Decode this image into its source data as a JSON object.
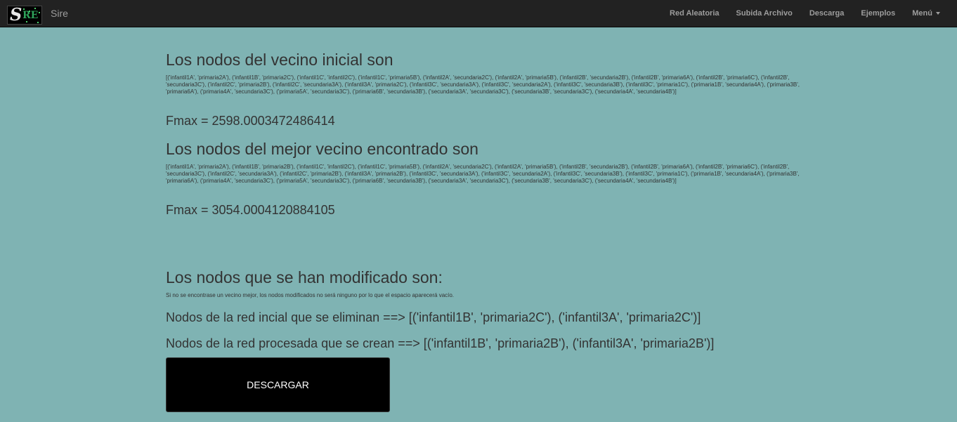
{
  "navbar": {
    "brand": "Sire",
    "links": [
      "Red Aleatoria",
      "Subida Archivo",
      "Descarga",
      "Ejemplos"
    ],
    "menu_label": "Menú"
  },
  "initial": {
    "heading": "Los nodos del vecino inicial son",
    "nodes_text": "[('infantil1A', 'primaria2A'), ('infantil1B', 'primaria2C'), ('infantil1C', 'infantil2C'), ('infantil1C', 'primaria5B'), ('infantil2A', 'secundaria2C'), ('infantil2A', 'primaria5B'), ('infantil2B', 'secundaria2B'), ('infantil2B', 'primaria6A'), ('infantil2B', 'primaria6C'), ('infantil2B', 'secundaria3C'), ('infantil2C', 'primaria2B'), ('infantil2C', 'secundaria3A'), ('infantil3A', 'primaria2C'), ('infantil3C', 'secundaria3A'), ('infantil3C', 'secundaria2A'), ('infantil3C', 'secundaria3B'), ('infantil3C', 'primaria1C'), ('primaria1B', 'secundaria4A'), ('primaria3B', 'primaria6A'), ('primaria4A', 'secundaria3C'), ('primaria5A', 'secundaria3C'), ('primaria6B', 'secundaria3B'), ('secundaria3A', 'secundaria3C'), ('secundaria3B', 'secundaria3C'), ('secundaria4A', 'secundaria4B')]",
    "fmax": "Fmax = 2598.0003472486414"
  },
  "best": {
    "heading": "Los nodos del mejor vecino encontrado son",
    "nodes_text": "[('infantil1A', 'primaria2A'), ('infantil1B', 'primaria2B'), ('infantil1C', 'infantil2C'), ('infantil1C', 'primaria5B'), ('infantil2A', 'secundaria2C'), ('infantil2A', 'primaria5B'), ('infantil2B', 'secundaria2B'), ('infantil2B', 'primaria6A'), ('infantil2B', 'primaria6C'), ('infantil2B', 'secundaria3C'), ('infantil2C', 'secundaria3A'), ('infantil2C', 'primaria2B'), ('infantil3A', 'primaria2B'), ('infantil3C', 'secundaria3A'), ('infantil3C', 'secundaria2A'), ('infantil3C', 'secundaria3B'), ('infantil3C', 'primaria1C'), ('primaria1B', 'secundaria4A'), ('primaria3B', 'primaria6A'), ('primaria4A', 'secundaria3C'), ('primaria5A', 'secundaria3C'), ('primaria6B', 'secundaria3B'), ('secundaria3A', 'secundaria3C'), ('secundaria3B', 'secundaria3C'), ('secundaria4A', 'secundaria4B')]",
    "fmax": "Fmax = 3054.0004120884105"
  },
  "modified": {
    "heading": "Los nodos que se han modificado son:",
    "note": "Si no se encontrase un vecino mejor, los nodos modificados no será ninguno por lo que el espacio aparecerá vacío.",
    "removed": "Nodos de la red incial que se eliminan ==> [('infantil1B', 'primaria2C'), ('infantil3A', 'primaria2C')]",
    "created": "Nodos de la red procesada que se crean ==> [('infantil1B', 'primaria2B'), ('infantil3A', 'primaria2B')]"
  },
  "download_label": "DESCARGAR"
}
